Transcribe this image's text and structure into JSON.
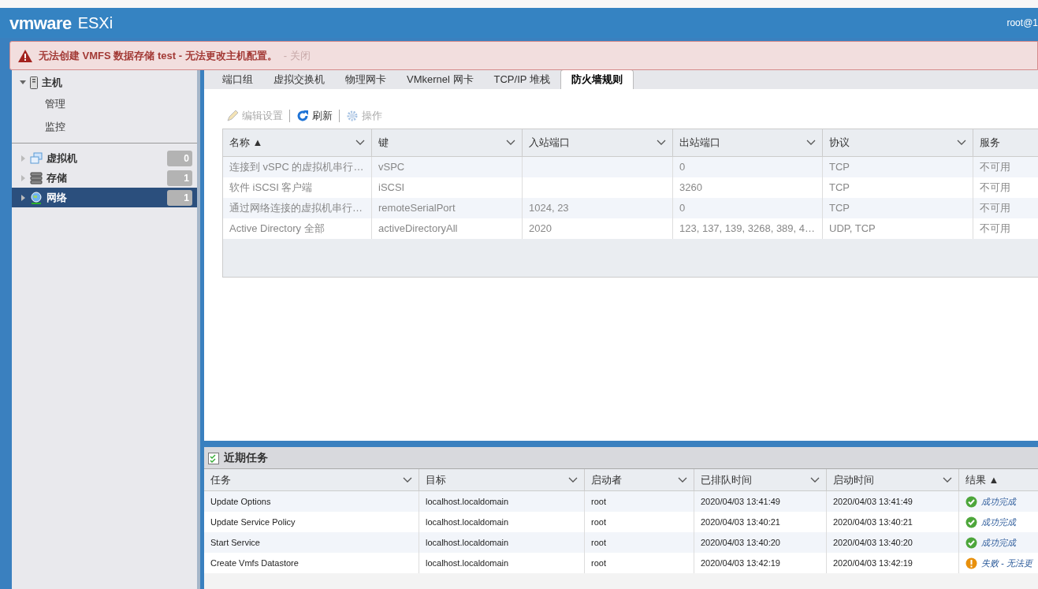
{
  "header": {
    "logo": "vmware",
    "product": "ESXi",
    "user": "root@1"
  },
  "alert": {
    "message": "无法创建 VMFS 数据存储 test - 无法更改主机配置。",
    "close": "- 关闭"
  },
  "sidebar": {
    "items": [
      {
        "label": "主机",
        "kind": "host",
        "expanded": true,
        "selected": false,
        "children": [
          {
            "label": "管理",
            "selected": false
          },
          {
            "label": "监控",
            "selected": false
          }
        ]
      },
      {
        "label": "虚拟机",
        "kind": "vm",
        "count": "0",
        "selected": false
      },
      {
        "label": "存储",
        "kind": "storage",
        "count": "1",
        "selected": false
      },
      {
        "label": "网络",
        "kind": "network",
        "count": "1",
        "selected": true
      }
    ]
  },
  "tabs": [
    {
      "label": "端口组",
      "selected": false
    },
    {
      "label": "虚拟交换机",
      "selected": false
    },
    {
      "label": "物理网卡",
      "selected": false
    },
    {
      "label": "VMkernel 网卡",
      "selected": false
    },
    {
      "label": "TCP/IP 堆栈",
      "selected": false
    },
    {
      "label": "防火墙规则",
      "selected": true
    }
  ],
  "toolbar": [
    {
      "label": "编辑设置",
      "kind": "edit",
      "disabled": true
    },
    {
      "label": "刷新",
      "kind": "refresh",
      "disabled": false
    },
    {
      "label": "操作",
      "kind": "actions",
      "disabled": true
    }
  ],
  "firewall_table": {
    "columns": [
      "名称 ▲",
      "键",
      "入站端口",
      "出站端口",
      "协议",
      "服务"
    ],
    "rows": [
      [
        "连接到 vSPC 的虚拟机串行…",
        "vSPC",
        "",
        "0",
        "TCP",
        "不可用"
      ],
      [
        "软件 iSCSI 客户端",
        "iSCSI",
        "",
        "3260",
        "TCP",
        "不可用"
      ],
      [
        "通过网络连接的虚拟机串行…",
        "remoteSerialPort",
        "1024, 23",
        "0",
        "TCP",
        "不可用"
      ],
      [
        "Active Directory 全部",
        "activeDirectoryAll",
        "2020",
        "123, 137, 139, 3268, 389, 4…",
        "UDP, TCP",
        "不可用"
      ]
    ]
  },
  "recent_tasks": {
    "title": "近期任务",
    "columns": [
      "任务",
      "目标",
      "启动者",
      "已排队时间",
      "启动时间",
      "结果 ▲"
    ],
    "rows": [
      {
        "task": "Update Options",
        "target": "localhost.localdomain",
        "initiator": "root",
        "queued": "2020/04/03 13:41:49",
        "started": "2020/04/03 13:41:49",
        "kind": "success",
        "result": "成功完成"
      },
      {
        "task": "Update Service Policy",
        "target": "localhost.localdomain",
        "initiator": "root",
        "queued": "2020/04/03 13:40:21",
        "started": "2020/04/03 13:40:21",
        "kind": "success",
        "result": "成功完成"
      },
      {
        "task": "Start Service",
        "target": "localhost.localdomain",
        "initiator": "root",
        "queued": "2020/04/03 13:40:20",
        "started": "2020/04/03 13:40:20",
        "kind": "success",
        "result": "成功完成"
      },
      {
        "task": "Create Vmfs Datastore",
        "target": "localhost.localdomain",
        "initiator": "root",
        "queued": "2020/04/03 13:42:19",
        "started": "2020/04/03 13:42:19",
        "kind": "failed",
        "result": "失败 - 无法更"
      }
    ]
  }
}
